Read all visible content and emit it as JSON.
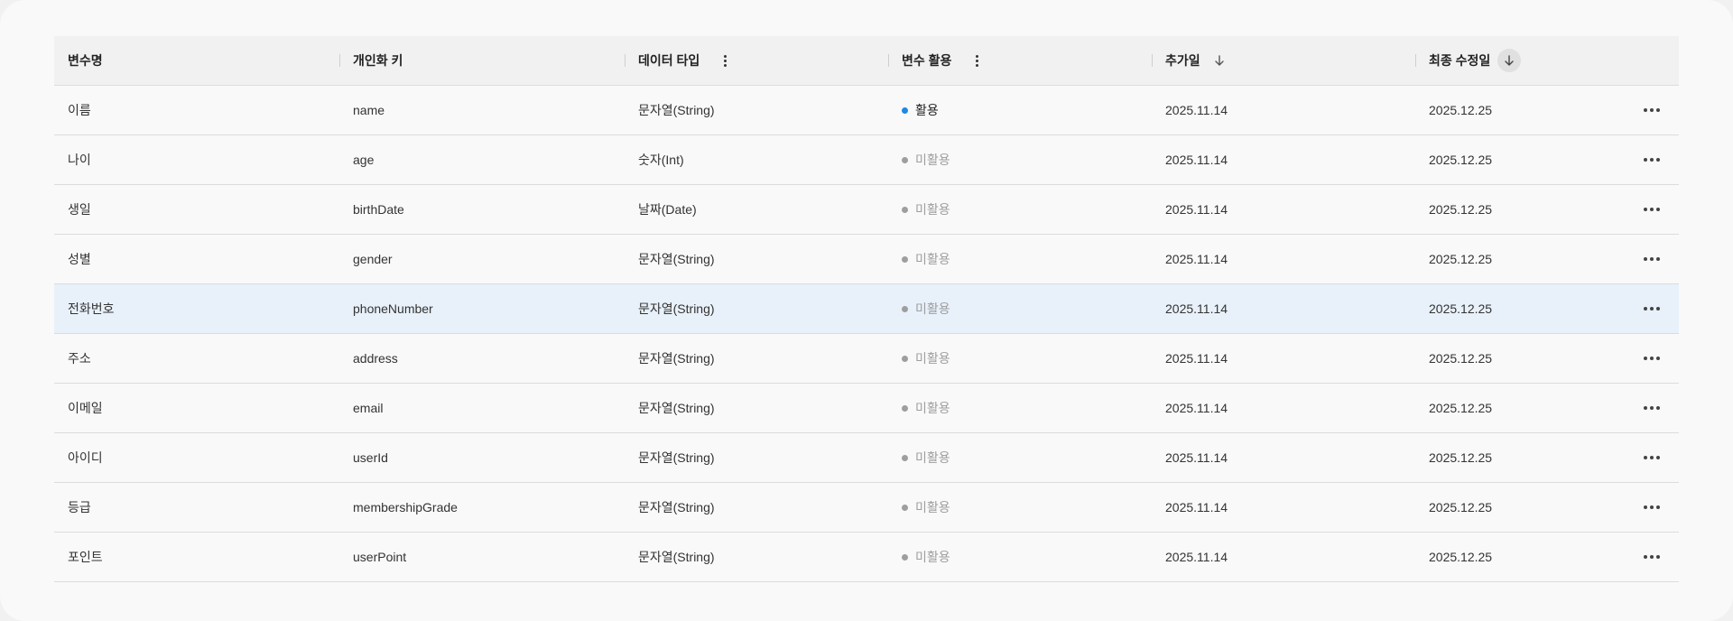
{
  "colors": {
    "active_dot": "#1e88e5",
    "inactive_dot": "#9e9e9e",
    "inactive_text": "#9e9e9e",
    "highlight_row": "#e8f1fa"
  },
  "header": {
    "col_name": "변수명",
    "col_key": "개인화 키",
    "col_type": "데이터 타입",
    "col_usage": "변수 활용",
    "col_added": "추가일",
    "col_modified": "최종 수정일"
  },
  "rows": [
    {
      "name": "이름",
      "key": "name",
      "type": "문자열(String)",
      "usage": "활용",
      "active": true,
      "added": "2025.11.14",
      "modified": "2025.12.25"
    },
    {
      "name": "나이",
      "key": "age",
      "type": "숫자(Int)",
      "usage": "미활용",
      "active": false,
      "added": "2025.11.14",
      "modified": "2025.12.25"
    },
    {
      "name": "생일",
      "key": "birthDate",
      "type": "날짜(Date)",
      "usage": "미활용",
      "active": false,
      "added": "2025.11.14",
      "modified": "2025.12.25"
    },
    {
      "name": "성별",
      "key": "gender",
      "type": "문자열(String)",
      "usage": "미활용",
      "active": false,
      "added": "2025.11.14",
      "modified": "2025.12.25"
    },
    {
      "name": "전화번호",
      "key": "phoneNumber",
      "type": "문자열(String)",
      "usage": "미활용",
      "active": false,
      "added": "2025.11.14",
      "modified": "2025.12.25"
    },
    {
      "name": "주소",
      "key": "address",
      "type": "문자열(String)",
      "usage": "미활용",
      "active": false,
      "added": "2025.11.14",
      "modified": "2025.12.25"
    },
    {
      "name": "이메일",
      "key": "email",
      "type": "문자열(String)",
      "usage": "미활용",
      "active": false,
      "added": "2025.11.14",
      "modified": "2025.12.25"
    },
    {
      "name": "아이디",
      "key": "userId",
      "type": "문자열(String)",
      "usage": "미활용",
      "active": false,
      "added": "2025.11.14",
      "modified": "2025.12.25"
    },
    {
      "name": "등급",
      "key": "membershipGrade",
      "type": "문자열(String)",
      "usage": "미활용",
      "active": false,
      "added": "2025.11.14",
      "modified": "2025.12.25"
    },
    {
      "name": "포인트",
      "key": "userPoint",
      "type": "문자열(String)",
      "usage": "미활용",
      "active": false,
      "added": "2025.11.14",
      "modified": "2025.12.25"
    }
  ],
  "highlighted_row": 4
}
